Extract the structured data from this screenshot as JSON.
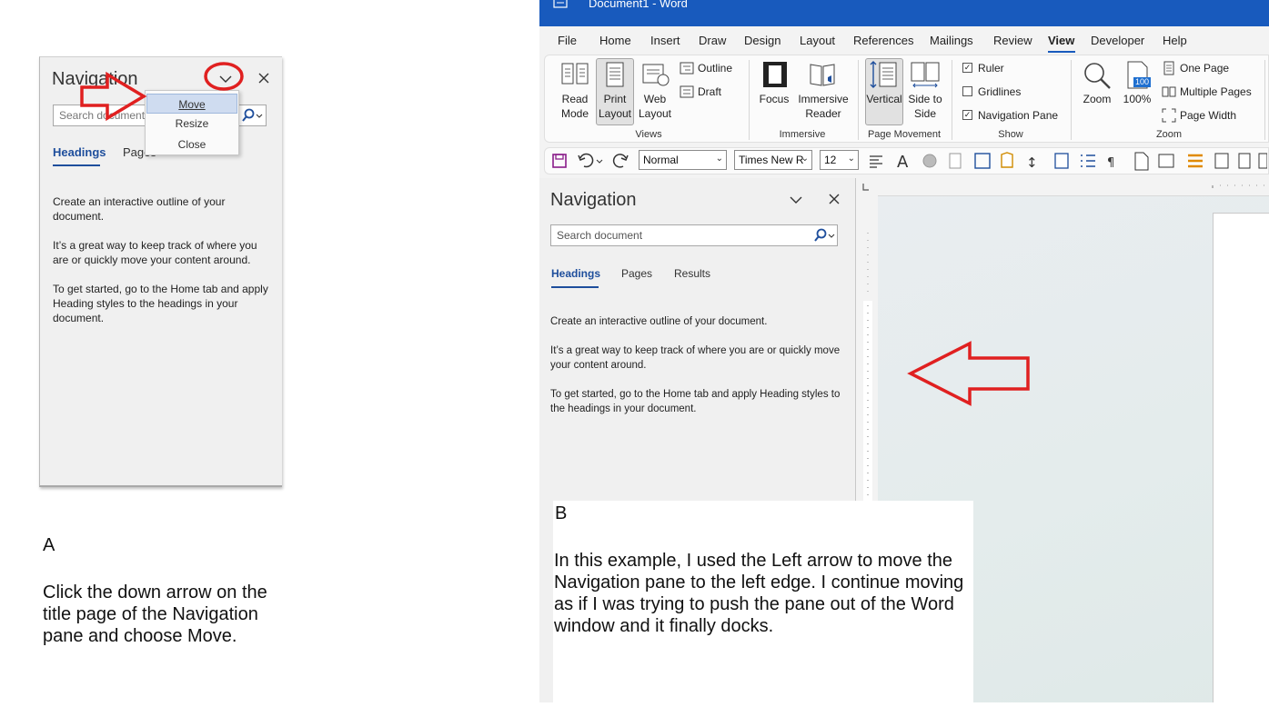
{
  "panel_a": {
    "title": "Navigation",
    "search_placeholder": "Search document",
    "tab_headings": "Headings",
    "tab_pages": "Pages",
    "menu": [
      {
        "label": "Move",
        "accel": "M",
        "selected": true
      },
      {
        "label": "Resize",
        "accel": "z",
        "selected": false
      },
      {
        "label": "Close",
        "accel": "C",
        "selected": false
      }
    ],
    "text1": "Create an interactive outline of your document.",
    "text2": "It’s a great way to keep track of where you are or quickly move your content around.",
    "text3": "To get started, go to the Home tab and apply Heading styles to the headings in your document.",
    "label": "A",
    "caption": "Click the down arrow on the title page of the Navigation pane and choose Move."
  },
  "panel_b": {
    "window_title": "Document1 - Word",
    "menu_tabs": [
      "File",
      "Home",
      "Insert",
      "Draw",
      "Design",
      "Layout",
      "References",
      "Mailings",
      "Review",
      "View",
      "Developer",
      "Help"
    ],
    "active_tab": "View",
    "ribbon": {
      "read_mode": "Read Mode",
      "print_layout": "Print Layout",
      "web_layout": "Web Layout",
      "outline": "Outline",
      "draft": "Draft",
      "views_group": "Views",
      "focus": "Focus",
      "immersive_reader": "Immersive Reader",
      "immersive_group": "Immersive",
      "vertical": "Vertical",
      "side_to_side": "Side to Side",
      "page_movement_group": "Page Movement",
      "ruler": "Ruler",
      "gridlines": "Gridlines",
      "navigation_pane": "Navigation Pane",
      "show_group": "Show",
      "zoom": "Zoom",
      "zoom_100": "100%",
      "zoom_100_badge": "100",
      "one_page": "One Page",
      "multiple_pages": "Multiple Pages",
      "page_width": "Page Width",
      "zoom_group": "Zoom"
    },
    "qat": {
      "style": "Normal",
      "font": "Times New R",
      "size": "12"
    },
    "nav": {
      "title": "Navigation",
      "search_placeholder": "Search document",
      "tabs": [
        "Headings",
        "Pages",
        "Results"
      ],
      "text1": "Create an interactive outline of your document.",
      "text2": "It’s a great way to keep track of where you are or quickly move your content around.",
      "text3": "To get started, go to the Home tab and apply Heading styles to the headings in your document."
    },
    "label": "B",
    "caption": "In this example, I used the Left arrow to move the Navigation pane to the left edge. I continue moving as if I was trying to push the pane out of the Word window and it finally docks."
  },
  "colors": {
    "word_blue": "#185abd",
    "annotation_red": "#e02020",
    "heading_blue": "#1e4e9c"
  }
}
